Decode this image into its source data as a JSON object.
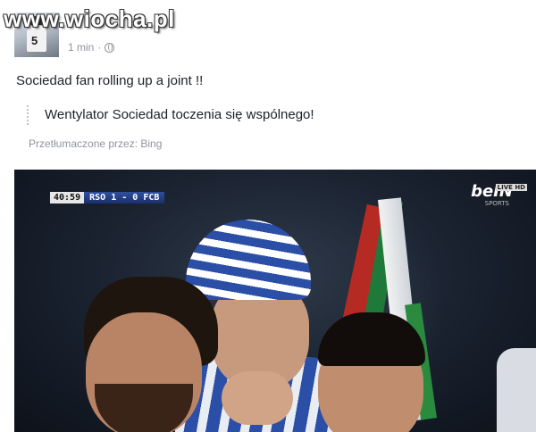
{
  "watermark": "www.wiocha.pl",
  "post": {
    "author": "",
    "time": "1 min",
    "separator": "·",
    "privacy_icon": "globe-icon",
    "text": "Sociedad fan rolling up a joint !!",
    "translation": "Wentylator Sociedad toczenia się wspólnego!",
    "translated_by": "Przetłumaczone przez: Bing"
  },
  "video": {
    "clock": "40:59",
    "score": "RSO 1 - 0 FCB",
    "channel": "beIN",
    "channel_tag": "LIVE HD",
    "channel_sub": "SPORTS"
  },
  "colors": {
    "link": "#365899",
    "meta": "#90949c",
    "text": "#1d2129",
    "scoreboard": "#2f4f9e"
  }
}
